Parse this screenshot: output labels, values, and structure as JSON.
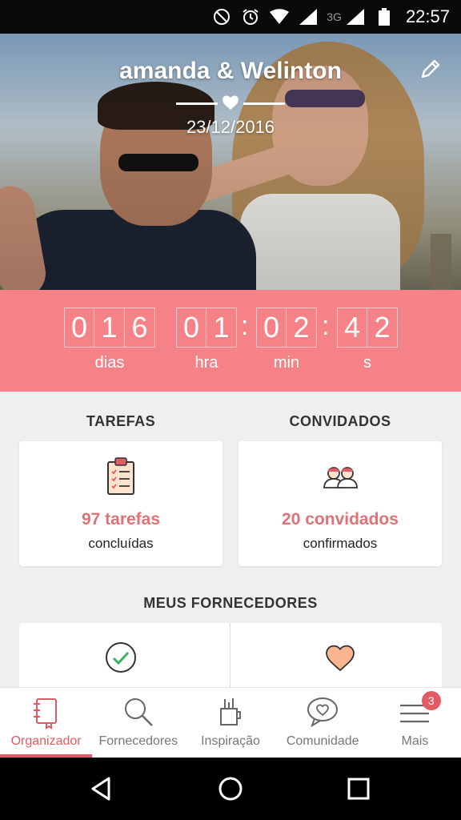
{
  "status_bar": {
    "icons": [
      "do-not-disturb-icon",
      "alarm-icon",
      "wifi-icon",
      "signal-icon",
      "battery-icon"
    ],
    "network": "3G",
    "time": "22:57"
  },
  "hero": {
    "couple_names": "amanda & Welinton",
    "wedding_date": "23/12/2016",
    "edit_icon": "pencil-icon"
  },
  "countdown": {
    "days": [
      "0",
      "1",
      "6"
    ],
    "hours": [
      "0",
      "1"
    ],
    "minutes": [
      "0",
      "2"
    ],
    "seconds": [
      "4",
      "2"
    ],
    "labels": {
      "days": "dias",
      "hours": "hra",
      "minutes": "min",
      "seconds": "s"
    },
    "separator": ":"
  },
  "tasks": {
    "title": "TAREFAS",
    "count": "97 tarefas",
    "subtitle": "concluídas",
    "icon": "clipboard-icon"
  },
  "guests": {
    "title": "CONVIDADOS",
    "count": "20 convidados",
    "subtitle": "confirmados",
    "icon": "guests-icon"
  },
  "vendors": {
    "title": "MEUS FORNECEDORES",
    "left_icon": "check-circle-icon",
    "right_icon": "heart-icon"
  },
  "bottom_nav": {
    "items": [
      {
        "label": "Organizador",
        "icon": "notebook-icon",
        "active": true
      },
      {
        "label": "Fornecedores",
        "icon": "search-icon",
        "active": false
      },
      {
        "label": "Inspiração",
        "icon": "pencil-cup-icon",
        "active": false
      },
      {
        "label": "Comunidade",
        "icon": "chat-heart-icon",
        "active": false
      },
      {
        "label": "Mais",
        "icon": "menu-icon",
        "active": false,
        "badge": "3"
      }
    ]
  },
  "system_nav": {
    "icons": [
      "back-icon",
      "home-icon",
      "recents-icon"
    ]
  },
  "colors": {
    "accent": "#f48287",
    "accent_text": "#e35b62",
    "background": "#efefef"
  }
}
